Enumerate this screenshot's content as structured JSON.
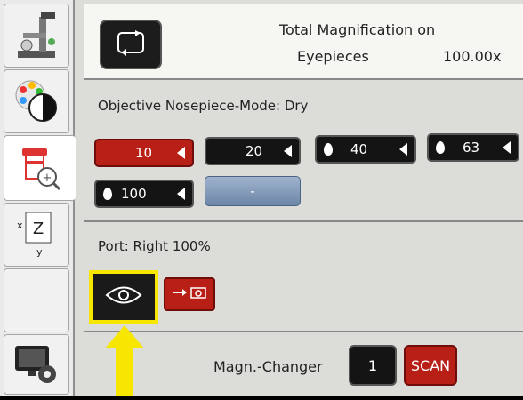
{
  "sidebar": {
    "tabs": [
      {
        "name": "microscope-tab",
        "icon": "microscope-icon"
      },
      {
        "name": "contrast-tab",
        "icon": "color-contrast-icon"
      },
      {
        "name": "objective-tab",
        "icon": "objective-zoom-icon",
        "active": true
      },
      {
        "name": "xyz-tab",
        "icon": "xyz-stage-icon",
        "x_label": "x",
        "y_label": "y",
        "z_label": "Z"
      },
      {
        "name": "empty-tab",
        "icon": ""
      },
      {
        "name": "settings-tab",
        "icon": "screen-settings-icon"
      }
    ]
  },
  "magnification": {
    "title": "Total Magnification on",
    "subtitle": "Eyepieces",
    "value": "100.00x"
  },
  "objective": {
    "label": "Objective Nosepiece-Mode: Dry",
    "buttons": [
      {
        "label": "10",
        "style": "red",
        "drop": false
      },
      {
        "label": "20",
        "style": "dark",
        "drop": false
      },
      {
        "label": "40",
        "style": "dark",
        "drop": true
      },
      {
        "label": "63",
        "style": "dark",
        "drop": true
      },
      {
        "label": "100",
        "style": "dark",
        "drop": true
      },
      {
        "label": "-",
        "style": "blank",
        "drop": false
      }
    ]
  },
  "port": {
    "label": "Port: Right 100%",
    "eyepiece_icon": "eye-icon",
    "camera_icon": "arrow-camera-icon"
  },
  "magn_changer": {
    "label": "Magn.-Changer",
    "value": "1",
    "scan_label": "SCAN"
  },
  "colors": {
    "accent_red": "#b81f17",
    "highlight_yellow": "#f6e600",
    "button_dark": "#141414"
  }
}
